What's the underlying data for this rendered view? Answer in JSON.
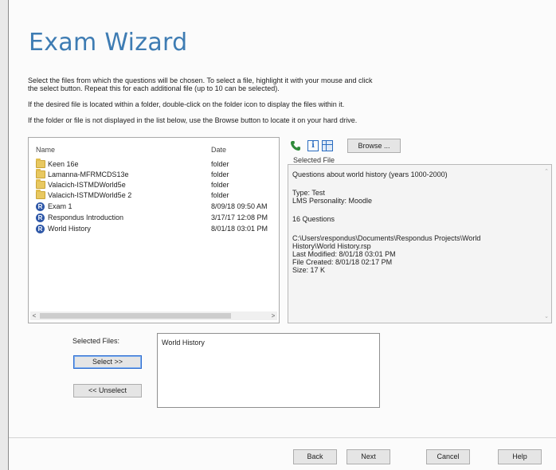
{
  "wizard": {
    "title": "Exam Wizard",
    "instructions": [
      "Select the files from which the questions will be chosen.  To select a file, highlight it with your mouse and click",
      "the select button.  Repeat this for each additional file (up to 10 can be selected).",
      "If the desired file is located within a folder, double-click on the folder icon to display the files within it.",
      "If the folder or file is not displayed in the list below, use the Browse button to locate it on your hard drive."
    ]
  },
  "file_list": {
    "columns": {
      "name": "Name",
      "date": "Date"
    },
    "rows": [
      {
        "name": "Keen 16e",
        "date": "folder",
        "icon": "folder-icon"
      },
      {
        "name": "Lamanna-MFRMCDS13e",
        "date": "folder",
        "icon": "folder-icon"
      },
      {
        "name": "Valacich-ISTMDWorld5e",
        "date": "folder",
        "icon": "folder-icon"
      },
      {
        "name": "Valacich-ISTMDWorld5e 2",
        "date": "folder",
        "icon": "folder-icon"
      },
      {
        "name": "Exam 1",
        "date": "8/09/18  09:50 AM",
        "icon": "respondus-icon",
        "glyph": "R"
      },
      {
        "name": "Respondus Introduction",
        "date": "3/17/17  12:08 PM",
        "icon": "respondus-icon",
        "glyph": "R"
      },
      {
        "name": "World History",
        "date": "8/01/18  03:01 PM",
        "icon": "respondus-icon",
        "glyph": "R"
      }
    ]
  },
  "toolbar": {
    "browse_label": "Browse ..."
  },
  "selected_file": {
    "label": "Selected File",
    "description": "Questions about world history (years 1000-2000)",
    "type": "Type: Test",
    "personality": "LMS Personality: Moodle",
    "questions": "16 Questions",
    "path_line1": "C:\\Users\\respondus\\Documents\\Respondus Projects\\World",
    "path_line2": "History\\World History.rsp",
    "last_modified": "Last Modified: 8/01/18  03:01 PM",
    "file_created": "File Created: 8/01/18  02:17 PM",
    "size": "Size: 17 K"
  },
  "selection": {
    "label": "Selected Files:",
    "select_label": "Select >>",
    "unselect_label": "<< Unselect",
    "items": [
      "World History"
    ]
  },
  "footer": {
    "back": "Back",
    "next": "Next",
    "cancel": "Cancel",
    "help": "Help"
  }
}
